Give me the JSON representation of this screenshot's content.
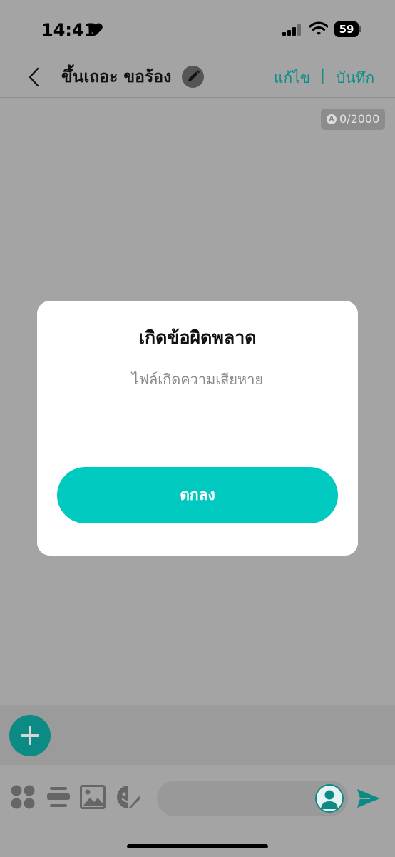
{
  "status": {
    "time": "14:41",
    "battery": "59"
  },
  "header": {
    "title": "ขึ้นเถอะ ขอร้อง",
    "edit_label": "แก้ไข",
    "separator": "|",
    "save_label": "บันทึก"
  },
  "editor": {
    "char_counter": "0/2000",
    "counter_icon": "A"
  },
  "dialog": {
    "title": "เกิดข้อผิดพลาด",
    "message": "ไฟล์เกิดความเสียหาย",
    "ok_label": "ตกลง"
  },
  "icons": {
    "heart": "heart-icon",
    "back": "chevron-left-icon",
    "pencil": "pencil-icon",
    "plus": "plus-icon",
    "apps": "apps-icon",
    "list": "list-icon",
    "image": "image-icon",
    "sticker": "sticker-icon",
    "avatar": "avatar-icon",
    "send": "send-icon"
  },
  "colors": {
    "accent": "#00c9bf",
    "accent_dark": "#0b8b84",
    "overlay": "#a4a4a4"
  }
}
